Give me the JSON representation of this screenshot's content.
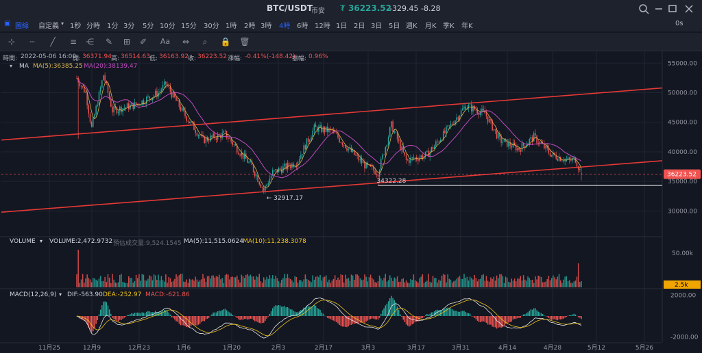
{
  "header": {
    "symbol": "BTC/USDT",
    "exchange": "币安",
    "currency_icon": "₮",
    "price": "36223.52",
    "change": "-329.45",
    "change_pct": "-8.28"
  },
  "timeframes": {
    "chart_type_label": "圖線",
    "custom_label": "自定義",
    "items": [
      "1秒",
      "分時",
      "1分",
      "3分",
      "5分",
      "10分",
      "15分",
      "30分",
      "1時",
      "2時",
      "3時",
      "4時",
      "6時",
      "12時",
      "1日",
      "2日",
      "3日",
      "5日",
      "週K",
      "月K",
      "季K",
      "年K"
    ],
    "active": "4時",
    "right_label": "0s"
  },
  "toolbar_icons": [
    "crosshair-icon",
    "ruler-icon",
    "trendline-icon",
    "channel-icon",
    "fib-icon",
    "brush-icon",
    "rect-icon",
    "pencil-icon",
    "text-icon",
    "measure-icon",
    "zoom-icon",
    "lock-icon",
    "trash-icon"
  ],
  "ohlc_bar": {
    "time_label": "時間:",
    "time": "2022-05-06 16:00",
    "open_label": "開:",
    "open": "36371.94",
    "high_label": "高:",
    "high": "36514.63",
    "low_label": "低:",
    "low": "36163.92",
    "close_label": "收:",
    "close": "36223.52",
    "change_label": "漲幅:",
    "change": "-0.41%(-148.42)",
    "amp_label": "振幅:",
    "amp": "0.96%"
  },
  "ma_legend": {
    "label": "MA",
    "ma5": "MA(5):36385.25",
    "ma20": "MA(20):38139.47"
  },
  "volume_legend": {
    "label": "VOLUME",
    "volume": "VOLUME:2,472.9732",
    "estimate": "預估成交量:9,524.1545",
    "ma5": "MA(5):11,515.0624",
    "ma10": "MA(10):11,238.3078"
  },
  "macd_legend": {
    "label": "MACD(12,26,9)",
    "dif": "DIF:-563.90",
    "dea": "DEA:-252.97",
    "macd": "MACD:-621.86"
  },
  "colors": {
    "up": "#26a69a",
    "down": "#ef5350",
    "ma5": "#d9b44a",
    "ma20": "#c04bc0",
    "channel": "#e53935",
    "accent": "#2962ff"
  },
  "chart_data": {
    "type": "candlestick",
    "price_axis": [
      "55000.00",
      "50000.00",
      "45000.00",
      "40000.00",
      "35000.00",
      "30000.00"
    ],
    "ylim": [
      26000,
      57000
    ],
    "x_ticks": [
      "11月25",
      "12月9",
      "12月23",
      "1月6",
      "1月20",
      "2月3",
      "2月17",
      "3月3",
      "3月17",
      "3月31",
      "4月14",
      "4月28",
      "5月12",
      "5月26"
    ],
    "last_price_label": "36223.52",
    "annotations": [
      {
        "text": "32917.17",
        "value": 32917.17
      },
      {
        "text": "34322.28",
        "value": 34322.28
      }
    ],
    "anchors": [
      {
        "i": 0,
        "v": 52500
      },
      {
        "i": 6,
        "v": 50000
      },
      {
        "i": 10,
        "v": 44000
      },
      {
        "i": 18,
        "v": 53000
      },
      {
        "i": 24,
        "v": 47000
      },
      {
        "i": 40,
        "v": 48000
      },
      {
        "i": 55,
        "v": 50000
      },
      {
        "i": 60,
        "v": 51500
      },
      {
        "i": 72,
        "v": 46500
      },
      {
        "i": 85,
        "v": 42000
      },
      {
        "i": 100,
        "v": 43000
      },
      {
        "i": 118,
        "v": 37500
      },
      {
        "i": 126,
        "v": 33500
      },
      {
        "i": 132,
        "v": 36500
      },
      {
        "i": 148,
        "v": 38200
      },
      {
        "i": 160,
        "v": 44000
      },
      {
        "i": 172,
        "v": 43500
      },
      {
        "i": 185,
        "v": 40000
      },
      {
        "i": 195,
        "v": 37500
      },
      {
        "i": 203,
        "v": 36500
      },
      {
        "i": 212,
        "v": 44500
      },
      {
        "i": 222,
        "v": 38500
      },
      {
        "i": 236,
        "v": 39500
      },
      {
        "i": 252,
        "v": 44500
      },
      {
        "i": 262,
        "v": 47800
      },
      {
        "i": 275,
        "v": 46500
      },
      {
        "i": 285,
        "v": 42000
      },
      {
        "i": 298,
        "v": 40500
      },
      {
        "i": 308,
        "v": 42500
      },
      {
        "i": 320,
        "v": 39500
      },
      {
        "i": 332,
        "v": 38500
      },
      {
        "i": 336,
        "v": 38800
      },
      {
        "i": 340,
        "v": 36223
      }
    ],
    "candle_count": 341,
    "channel_upper": {
      "from": 42000,
      "to": 50800
    },
    "channel_lower": {
      "from": 29800,
      "to": 38500
    },
    "support_level": 34322.28,
    "volume_axis": [
      "50.00k"
    ],
    "volume_label": "2.5k",
    "volume_ylim": [
      0,
      60000
    ],
    "macd_axis": [
      "2000.00",
      "-2000.00"
    ],
    "macd_ylim": [
      -2500,
      2500
    ]
  }
}
